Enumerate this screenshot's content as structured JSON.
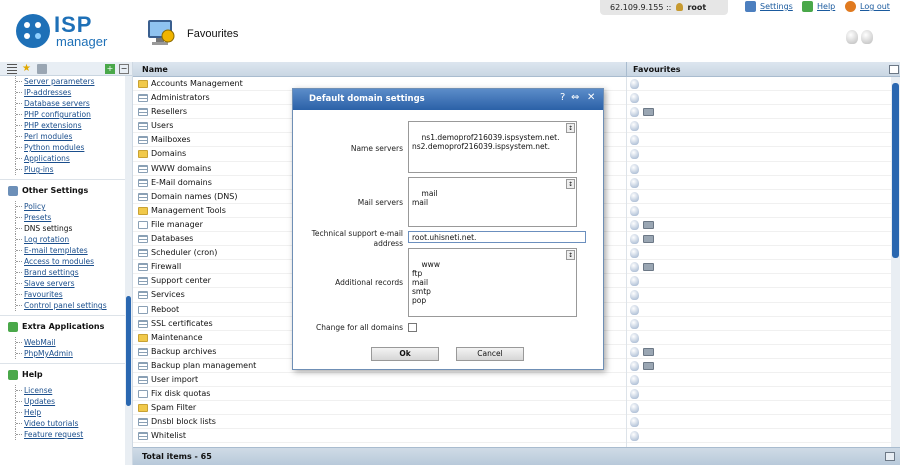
{
  "header": {
    "logo_isp": "ISP",
    "logo_manager": "manager",
    "page_title": "Favourites"
  },
  "userbar": {
    "ip": "62.109.9.155 ::",
    "user": "root",
    "settings": "Settings",
    "help": "Help",
    "logout": "Log out"
  },
  "sidebar": {
    "group1": [
      "Server parameters",
      "IP-addresses",
      "Database servers",
      "PHP configuration",
      "PHP extensions",
      "Perl modules",
      "Python modules",
      "Applications",
      "Plug-ins"
    ],
    "other_settings_title": "Other Settings",
    "group2": [
      "Policy",
      "Presets",
      "DNS settings",
      "Log rotation",
      "E-mail templates",
      "Access to modules",
      "Brand settings",
      "Slave servers",
      "Favourites",
      "Control panel settings"
    ],
    "extra_title": "Extra Applications",
    "group3": [
      "WebMail",
      "PhpMyAdmin"
    ],
    "help_title": "Help",
    "group4": [
      "License",
      "Updates",
      "Help",
      "Video tutorials",
      "Feature request"
    ]
  },
  "table": {
    "col_name": "Name",
    "col_fav": "Favourites",
    "rows": [
      {
        "name": "Accounts Management",
        "icon": "folder",
        "extra": false
      },
      {
        "name": "Administrators",
        "icon": "list",
        "extra": false
      },
      {
        "name": "Resellers",
        "icon": "list",
        "extra": true
      },
      {
        "name": "Users",
        "icon": "list",
        "extra": false
      },
      {
        "name": "Mailboxes",
        "icon": "list",
        "extra": false
      },
      {
        "name": "Domains",
        "icon": "folder",
        "extra": false
      },
      {
        "name": "WWW domains",
        "icon": "list",
        "extra": false
      },
      {
        "name": "E-Mail domains",
        "icon": "list",
        "extra": false
      },
      {
        "name": "Domain names (DNS)",
        "icon": "list",
        "extra": false
      },
      {
        "name": "Management Tools",
        "icon": "folder",
        "extra": false
      },
      {
        "name": "File manager",
        "icon": "doc",
        "extra": true
      },
      {
        "name": "Databases",
        "icon": "list",
        "extra": true
      },
      {
        "name": "Scheduler (cron)",
        "icon": "list",
        "extra": false
      },
      {
        "name": "Firewall",
        "icon": "list",
        "extra": true
      },
      {
        "name": "Support center",
        "icon": "list",
        "extra": false
      },
      {
        "name": "Services",
        "icon": "list",
        "extra": false
      },
      {
        "name": "Reboot",
        "icon": "doc",
        "extra": false
      },
      {
        "name": "SSL certificates",
        "icon": "list",
        "extra": false
      },
      {
        "name": "Maintenance",
        "icon": "folder",
        "extra": false
      },
      {
        "name": "Backup archives",
        "icon": "list",
        "extra": true
      },
      {
        "name": "Backup plan management",
        "icon": "list",
        "extra": true
      },
      {
        "name": "User import",
        "icon": "list",
        "extra": false
      },
      {
        "name": "Fix disk quotas",
        "icon": "doc",
        "extra": false
      },
      {
        "name": "Spam Filter",
        "icon": "folder",
        "extra": false
      },
      {
        "name": "Dnsbl block lists",
        "icon": "list",
        "extra": false
      },
      {
        "name": "Whitelist",
        "icon": "list",
        "extra": false
      }
    ],
    "total": "Total items - 65"
  },
  "dialog": {
    "title": "Default domain settings",
    "name_servers_label": "Name servers",
    "name_servers_value": "ns1.demoprof216039.ispsystem.net.\nns2.demoprof216039.ispsystem.net.",
    "mail_servers_label": "Mail servers",
    "mail_servers_value": "mail\nmail",
    "support_email_label": "Technical support e-mail address",
    "support_email_value": "root.uhisneti.net.",
    "additional_records_label": "Additional records",
    "additional_records_value": "www\nftp\nmail\nsmtp\npop",
    "change_all_label": "Change for all domains",
    "ok_label": "Ok",
    "cancel_label": "Cancel"
  },
  "colors": {
    "brand": "#1e70b7",
    "title_bar": "#2b61a7",
    "link": "#1a4e8c"
  }
}
